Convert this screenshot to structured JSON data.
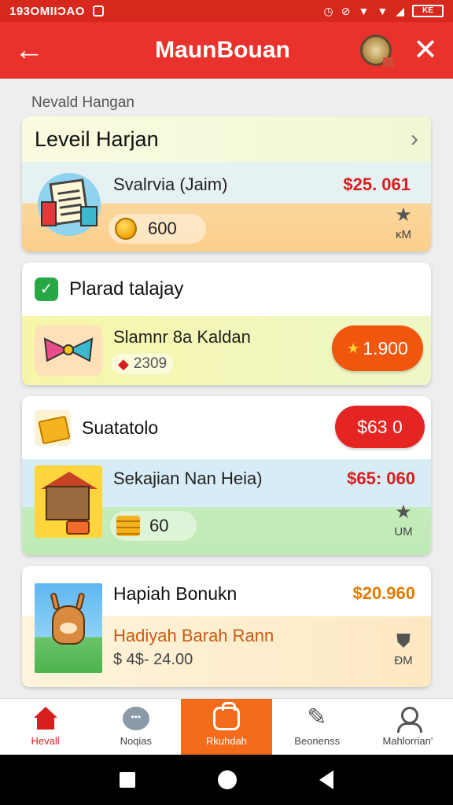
{
  "status_bar": {
    "time": "193OMIIƆAO",
    "battery": "KE"
  },
  "app_bar": {
    "back_icon": "arrow-left-icon",
    "title": "MaunBouan",
    "medal_icon": "medal-icon",
    "close_icon": "close-icon",
    "color": "#e8322b"
  },
  "section_label": "Nevald Hangan",
  "card1": {
    "header": "Leveil Harjan",
    "item_name": "Svalrvia (Jaim)",
    "price": "$25. 061",
    "coins": "600",
    "badge": "ĸM"
  },
  "card2": {
    "header": "Plarad talajay",
    "item_name": "Slamnr 8a Kaldan",
    "sub_value": "2309",
    "button_label": "1.900"
  },
  "card3": {
    "header": "Suatatolo",
    "button_label": "$63 0",
    "item_name": "Sekajian Nan Heia)",
    "price": "$65: 060",
    "coins": "60",
    "badge": "UM"
  },
  "card4": {
    "title": "Hapiah Bonukn",
    "price": "$20.960",
    "subtitle": "Hadiyah Barah Rann",
    "value": "$ 4$- 24.00",
    "badge": "ÐM"
  },
  "bottom_nav": [
    {
      "label": "Hevall",
      "icon": "home-icon"
    },
    {
      "label": "Noqias",
      "icon": "chat-icon"
    },
    {
      "label": "Rkuhdah",
      "icon": "bag-icon"
    },
    {
      "label": "Beonenss",
      "icon": "edit-icon"
    },
    {
      "label": "Mahlorrian'",
      "icon": "profile-icon"
    }
  ]
}
